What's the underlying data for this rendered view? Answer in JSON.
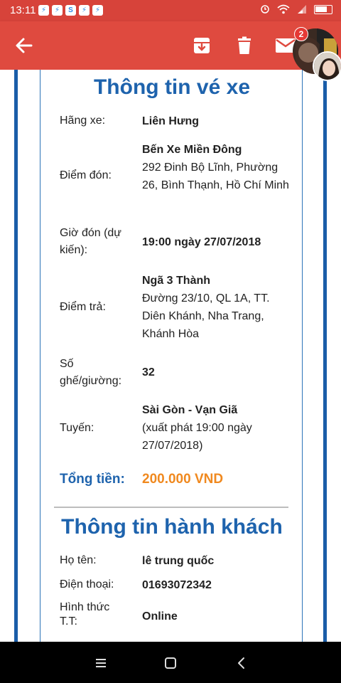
{
  "status_bar": {
    "time": "13:11",
    "notifications": [
      "messenger-icon",
      "messenger-icon",
      "skype-icon",
      "messenger-icon",
      "messenger-icon"
    ]
  },
  "app_bar": {
    "unread_count": "2",
    "colors": {
      "app_bar": "#df4a3f",
      "status_bar": "#d7433a"
    }
  },
  "ticket": {
    "title": "Thông tin vé xe",
    "carrier_label": "Hãng xe:",
    "carrier": "Liên Hưng",
    "pickup_label": "Điểm đón:",
    "pickup_name": "Bến Xe Miền Đông",
    "pickup_address": "292 Đinh Bộ Lĩnh, Phường 26, Bình Thạnh, Hồ Chí Minh",
    "pickup_time_label": "Giờ đón (dự kiến):",
    "pickup_time": "19:00 ngày 27/07/2018",
    "dropoff_label": "Điểm trả:",
    "dropoff_name": "Ngã 3 Thành",
    "dropoff_address": "Đường 23/10, QL 1A, TT. Diên Khánh, Nha Trang, Khánh Hòa",
    "seat_label": "Số ghế/giường:",
    "seat": "32",
    "route_label": "Tuyến:",
    "route_name": "Sài Gòn - Vạn Giã",
    "route_departure": "(xuất phát 19:00 ngày 27/07/2018)",
    "total_label": "Tổng tiền:",
    "total": "200.000 VND",
    "colors": {
      "title": "#1e63ad",
      "total": "#f0891f"
    }
  },
  "passenger": {
    "title": "Thông tin hành khách",
    "name_label": "Họ tên:",
    "name": "lê trung quốc",
    "phone_label": "Điện thoại:",
    "phone": "01693072342",
    "payment_label": "Hình thức T.T:",
    "payment": "Online"
  }
}
